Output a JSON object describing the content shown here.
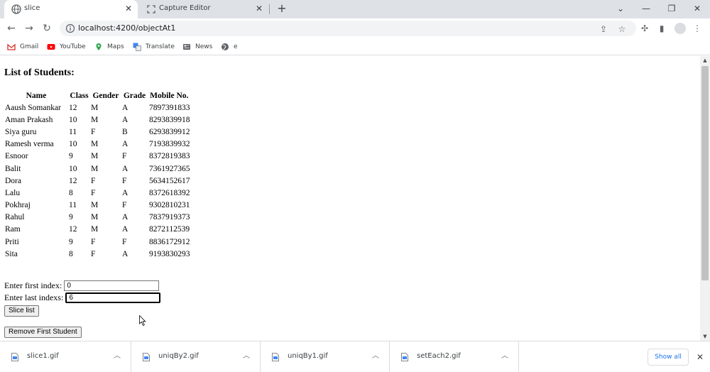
{
  "browser": {
    "tabs": [
      {
        "title": "slice"
      },
      {
        "title": "Capture Editor"
      }
    ],
    "url": "localhost:4200/objectAt1",
    "bookmarks": [
      {
        "label": "Gmail"
      },
      {
        "label": "YouTube"
      },
      {
        "label": "Maps"
      },
      {
        "label": "Translate"
      },
      {
        "label": "News"
      },
      {
        "label": "e"
      }
    ]
  },
  "page": {
    "heading": "List of Students:",
    "table": {
      "headers": [
        "Name",
        "Class",
        "Gender",
        "Grade",
        "Mobile No."
      ],
      "rows": [
        [
          "Aaush Somankar",
          "12",
          "M",
          "A",
          "7897391833"
        ],
        [
          "Aman Prakash",
          "10",
          "M",
          "A",
          "8293839918"
        ],
        [
          "Siya guru",
          "11",
          "F",
          "B",
          "6293839912"
        ],
        [
          "Ramesh verma",
          "10",
          "M",
          "A",
          "7193839932"
        ],
        [
          "Esnoor",
          "9",
          "M",
          "F",
          "8372819383"
        ],
        [
          "Balit",
          "10",
          "M",
          "A",
          "7361927365"
        ],
        [
          "Dora",
          "12",
          "F",
          "F",
          "5634152617"
        ],
        [
          "Lalu",
          "8",
          "F",
          "A",
          "8372618392"
        ],
        [
          "Pokhraj",
          "11",
          "M",
          "F",
          "9302810231"
        ],
        [
          "Rahul",
          "9",
          "M",
          "A",
          "7837919373"
        ],
        [
          "Ram",
          "12",
          "M",
          "A",
          "8272112539"
        ],
        [
          "Priti",
          "9",
          "F",
          "F",
          "8836172912"
        ],
        [
          "Sita",
          "8",
          "F",
          "A",
          "9193830293"
        ]
      ]
    },
    "form": {
      "first_label": "Enter first index:",
      "first_value": "0",
      "last_label": "Enter last indexs:",
      "last_value": "6",
      "slice_button": "Slice list",
      "remove_button": "Remove First Student"
    }
  },
  "downloads": {
    "items": [
      {
        "filename": "slice1.gif"
      },
      {
        "filename": "uniqBy2.gif"
      },
      {
        "filename": "uniqBy1.gif"
      },
      {
        "filename": "setEach2.gif"
      }
    ],
    "show_all": "Show all"
  },
  "colors": {
    "tabstrip": "#dee1e6",
    "accent": "#1a73e8",
    "omnibox": "#f1f3f4"
  }
}
